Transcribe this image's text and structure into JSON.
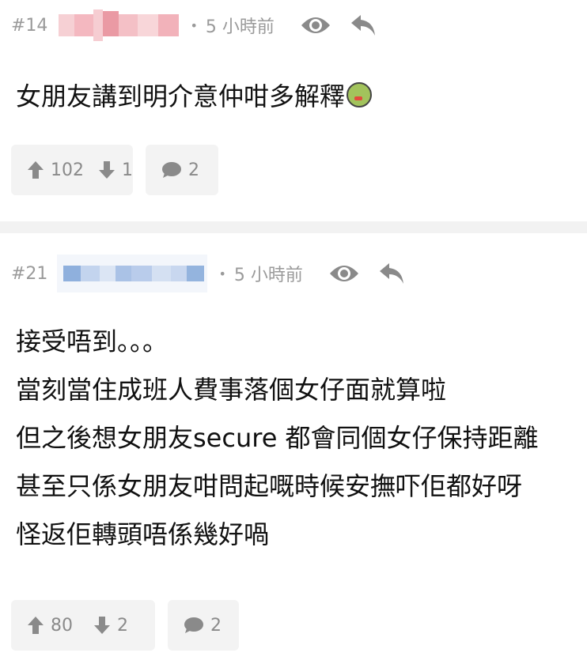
{
  "posts": [
    {
      "floor": "#14",
      "time": "5 小時前",
      "content_lines": [
        "女朋友講到明介意仲咁多解釋"
      ],
      "emoji": "nauseated-face-icon",
      "upvotes": "102",
      "downvotes": "1",
      "replies": "2"
    },
    {
      "floor": "#21",
      "time": "5 小時前",
      "content_lines": [
        "接受唔到。。。",
        "當刻當住成班人費事落個女仔面就算啦",
        "但之後想女朋友secure 都會同個女仔保持距離",
        "甚至只係女朋友咁問起嘅時候安撫吓佢都好呀",
        "怪返佢轉頭唔係幾好喎"
      ],
      "upvotes": "80",
      "downvotes": "2",
      "replies": "2"
    }
  ],
  "colors": {
    "meta_text": "#9a9a9a",
    "action_bg": "#f3f3f3",
    "separator": "#f2f2f2",
    "username_blur_a": "#f0a0a8",
    "username_blur_b": "#8fb0dd"
  },
  "icons": [
    "eye-icon",
    "reply-arrow-icon",
    "thumb-up-arrow-icon",
    "thumb-down-arrow-icon",
    "comment-bubble-icon"
  ]
}
